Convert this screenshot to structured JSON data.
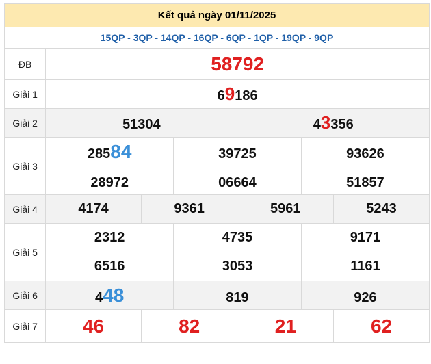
{
  "header": {
    "title": "Kết quả ngày 01/11/2025"
  },
  "codes": "15QP - 3QP - 14QP - 16QP - 6QP - 1QP - 19QP - 9QP",
  "labels": {
    "db": "ĐB",
    "g1": "Giải 1",
    "g2": "Giải 2",
    "g3": "Giải 3",
    "g4": "Giải 4",
    "g5": "Giải 5",
    "g6": "Giải 6",
    "g7": "Giải 7"
  },
  "db": "58792",
  "g1": {
    "pre": "6",
    "hl": "9",
    "post": "186"
  },
  "g2": [
    {
      "pre": "51304",
      "hl": "",
      "post": ""
    },
    {
      "pre": "4",
      "hl": "3",
      "post": "356"
    }
  ],
  "g3": [
    {
      "pre": "285",
      "hl": "84"
    },
    {
      "pre": "39725",
      "hl": ""
    },
    {
      "pre": "93626",
      "hl": ""
    },
    {
      "pre": "28972",
      "hl": ""
    },
    {
      "pre": "06664",
      "hl": ""
    },
    {
      "pre": "51857",
      "hl": ""
    }
  ],
  "g4": [
    "4174",
    "9361",
    "5961",
    "5243"
  ],
  "g5": [
    "2312",
    "4735",
    "9171",
    "6516",
    "3053",
    "1161"
  ],
  "g6": [
    {
      "pre": "4",
      "hl": "48"
    },
    {
      "pre": "819",
      "hl": ""
    },
    {
      "pre": "926",
      "hl": ""
    }
  ],
  "g7": [
    "46",
    "82",
    "21",
    "62"
  ]
}
